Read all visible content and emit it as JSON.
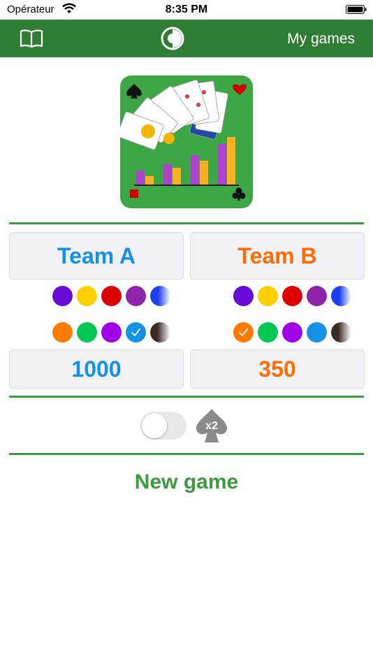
{
  "status_bar": {
    "carrier": "Opérateur",
    "time": "8:35 PM"
  },
  "nav": {
    "my_games_label": "My games",
    "left_icon": "book-icon",
    "center_icon": "app-logo-icon"
  },
  "teams": [
    {
      "name": "Team A",
      "color": "#1592e6",
      "score": "1000",
      "palette_row1": [
        "#6a0ad6",
        "#ffd000",
        "#dc0000",
        "#8e24aa",
        "gradient-blue"
      ],
      "palette_row2": [
        "#ff7b00",
        "#00c853",
        "#a100e6",
        "#1592e6",
        "gradient-brown"
      ],
      "selected_index": 8
    },
    {
      "name": "Team B",
      "color": "#ff6d00",
      "score": "350",
      "palette_row1": [
        "#6a0ad6",
        "#ffd000",
        "#dc0000",
        "#8e24aa",
        "gradient-blue"
      ],
      "palette_row2": [
        "#ff7b00",
        "#00c853",
        "#a100e6",
        "#1592e6",
        "gradient-brown"
      ],
      "selected_index": 5
    }
  ],
  "double_toggle": {
    "on": false,
    "badge": "x2",
    "icon": "spade-icon"
  },
  "new_game_label": "New game",
  "colors": {
    "nav_green": "#2f7d32",
    "accent_green": "#3c9a3f"
  }
}
